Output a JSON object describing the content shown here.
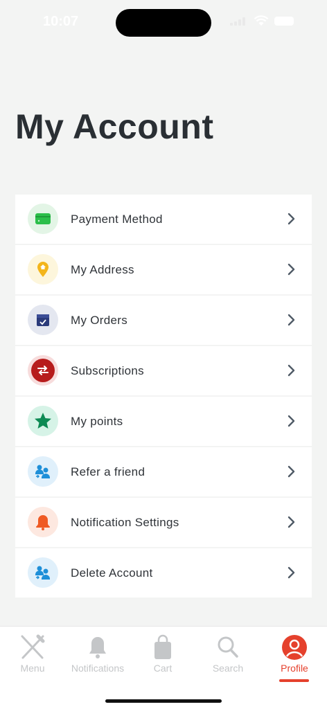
{
  "status": {
    "time": "10:07"
  },
  "page": {
    "title": "My Account"
  },
  "menu": {
    "items": [
      {
        "label": "Payment Method",
        "icon": "credit-card-icon",
        "bg": "#e3f5e6",
        "color": "#2bbf4a"
      },
      {
        "label": "My Address",
        "icon": "location-pin-icon",
        "bg": "#fdf6dc",
        "color": "#f3b51b"
      },
      {
        "label": "My Orders",
        "icon": "orders-box-icon",
        "bg": "#e4e7f0",
        "color": "#2a3a7a"
      },
      {
        "label": "Subscriptions",
        "icon": "subscription-icon",
        "bg": "#f7dcdc",
        "color": "#b71c1c"
      },
      {
        "label": "My points",
        "icon": "star-icon",
        "bg": "#d6f3e7",
        "color": "#0d8a54"
      },
      {
        "label": "Refer a friend",
        "icon": "refer-friend-icon",
        "bg": "#e0f0fb",
        "color": "#1e8fd8"
      },
      {
        "label": "Notification Settings",
        "icon": "bell-icon",
        "bg": "#fde8e0",
        "color": "#ef5a23"
      },
      {
        "label": "Delete Account",
        "icon": "delete-account-icon",
        "bg": "#e0f0fb",
        "color": "#1e8fd8"
      }
    ]
  },
  "tabs": [
    {
      "label": "Menu",
      "icon": "fork-knife-icon",
      "active": false
    },
    {
      "label": "Notifications",
      "icon": "bell-icon",
      "active": false
    },
    {
      "label": "Cart",
      "icon": "shopping-bag-icon",
      "active": false
    },
    {
      "label": "Search",
      "icon": "search-icon",
      "active": false
    },
    {
      "label": "Profile",
      "icon": "profile-icon",
      "active": true
    }
  ],
  "colors": {
    "accent": "#e5412d",
    "background": "#f3f4f3"
  }
}
